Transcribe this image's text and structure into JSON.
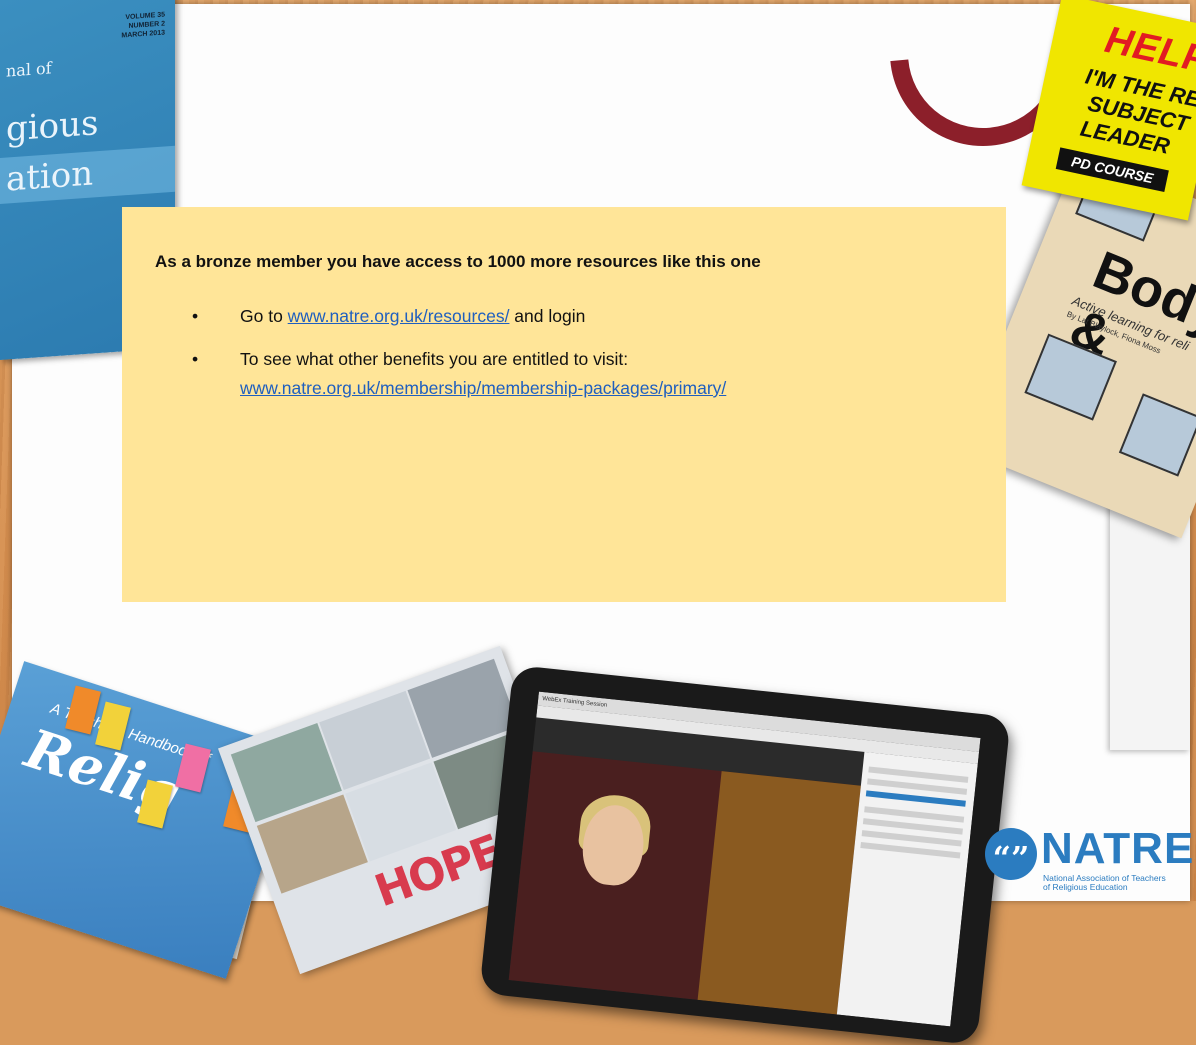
{
  "callout": {
    "title": "As a bronze member you have access to 1000 more resources like this one",
    "items": [
      {
        "prefix": "Go to ",
        "link": "www.natre.org.uk/resources/",
        "suffix": " and login"
      },
      {
        "prefix": "To see what other benefits you are entitled to visit:",
        "link": "www.natre.org.uk/membership/membership-packages/primary/",
        "suffix": ""
      }
    ]
  },
  "decor": {
    "journal": {
      "vol": "VOLUME 35",
      "num": "NUMBER 2",
      "date": "MARCH 2013",
      "line1": "nal of",
      "line2": "gious",
      "line3": "ation"
    },
    "badge": {
      "help": "HELP!",
      "line1": "I'M THE RE",
      "line2": "SUBJECT",
      "line3": "LEADER",
      "pd": "PD COURSE"
    },
    "bodybook": {
      "title": "Body &",
      "subtitle": "Active learning for reli",
      "authors": "By Lat Blaylock, Fiona Moss"
    },
    "handbook": {
      "top": "A Teacher's Handbook of",
      "big": "Relig"
    },
    "collage_word": "HOPE",
    "tablet_bar": "WebEx Training Session"
  },
  "logo": {
    "word": "NATRE",
    "mark": "“”",
    "tagline1": "National Association of Teachers",
    "tagline2": "of Religious Education"
  },
  "colors": {
    "callout": "#ffe598",
    "link": "#1f5fbf",
    "brand": "#2b7cc0"
  }
}
